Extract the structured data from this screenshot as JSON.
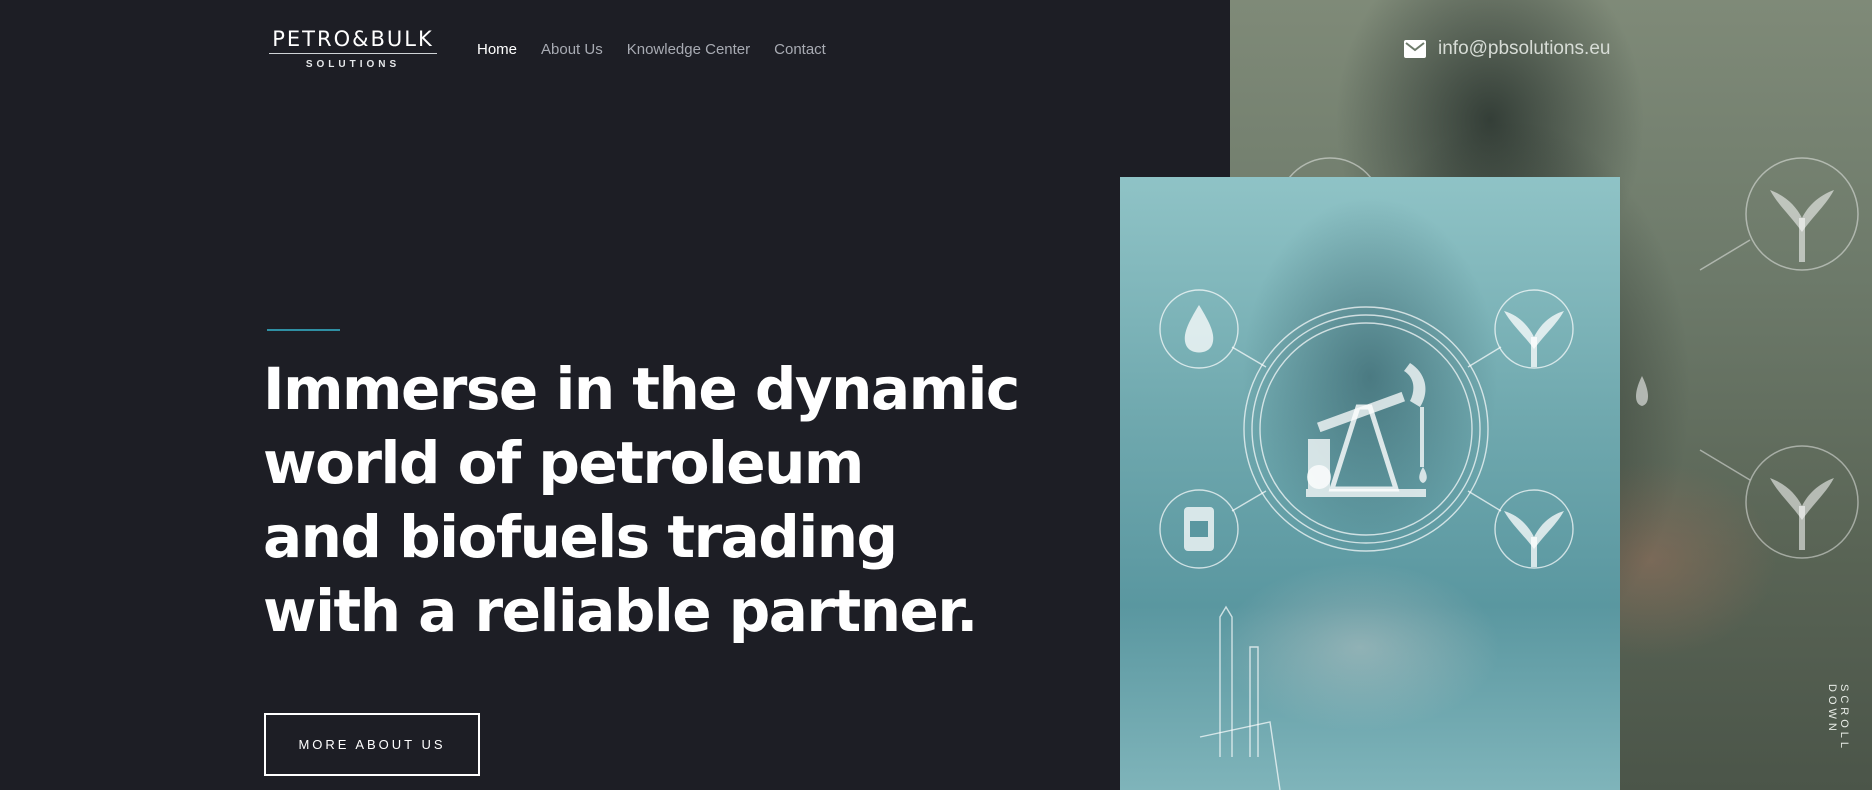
{
  "header": {
    "logo": {
      "main": "PETRO&BULK",
      "sub": "SOLUTIONS"
    },
    "nav": [
      {
        "label": "Home",
        "active": true
      },
      {
        "label": "About Us",
        "active": false
      },
      {
        "label": "Knowledge Center",
        "active": false
      },
      {
        "label": "Contact",
        "active": false
      }
    ],
    "email": {
      "icon": "mail-icon",
      "text": "info@pbsolutions.eu"
    }
  },
  "hero": {
    "title_lines": [
      "Immerse in the dynamic",
      "world of petroleum",
      "and biofuels trading",
      "with a reliable partner."
    ],
    "button_label": "MORE ABOUT US",
    "scroll_label": "SCROLL DOWN"
  },
  "colors": {
    "background": "#1d1e25",
    "accent": "#2f8fa3",
    "foreground_photo_tint": "#6fa8ae",
    "background_photo_tint": "#6d7a6a"
  }
}
